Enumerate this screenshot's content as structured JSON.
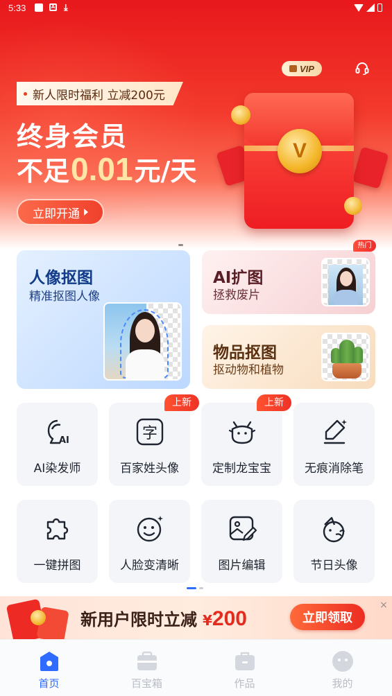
{
  "status_bar": {
    "time": "5:33"
  },
  "hero": {
    "vip_label": "VIP",
    "promo_text": "新人限时福利 立减200元",
    "line1": "终身会员",
    "line2_prefix": "不足",
    "line2_price": "0.01",
    "line2_suffix": "元/天",
    "cta": "立即开通",
    "coin_letter": "V"
  },
  "feature_cards": {
    "portrait": {
      "title": "人像抠图",
      "subtitle": "精准抠图人像"
    },
    "ai_expand": {
      "title": "AI扩图",
      "subtitle": "拯救废片",
      "badge": "热门"
    },
    "object": {
      "title": "物品抠图",
      "subtitle": "抠动物和植物"
    }
  },
  "tools": [
    {
      "label": "AI染发师",
      "icon": "ai-hair-dye-icon",
      "badge": ""
    },
    {
      "label": "百家姓头像",
      "icon": "surname-avatar-icon",
      "badge": "上新"
    },
    {
      "label": "定制龙宝宝",
      "icon": "dragon-baby-icon",
      "badge": "上新"
    },
    {
      "label": "无痕消除笔",
      "icon": "eraser-pen-icon",
      "badge": ""
    },
    {
      "label": "一键拼图",
      "icon": "puzzle-icon",
      "badge": ""
    },
    {
      "label": "人脸变清晰",
      "icon": "face-enhance-icon",
      "badge": ""
    },
    {
      "label": "图片编辑",
      "icon": "image-edit-icon",
      "badge": ""
    },
    {
      "label": "节日头像",
      "icon": "festival-avatar-icon",
      "badge": ""
    }
  ],
  "promo_strip": {
    "text": "新用户限时立减",
    "currency": "¥",
    "amount": "200",
    "cta": "立即领取",
    "close": "×"
  },
  "bottom_nav": [
    {
      "label": "首页",
      "active": true
    },
    {
      "label": "百宝箱",
      "active": false
    },
    {
      "label": "作品",
      "active": false
    },
    {
      "label": "我的",
      "active": false
    }
  ],
  "colors": {
    "brand_red": "#ee1d22",
    "accent_blue": "#2f6bff",
    "gold": "#f4b628"
  }
}
